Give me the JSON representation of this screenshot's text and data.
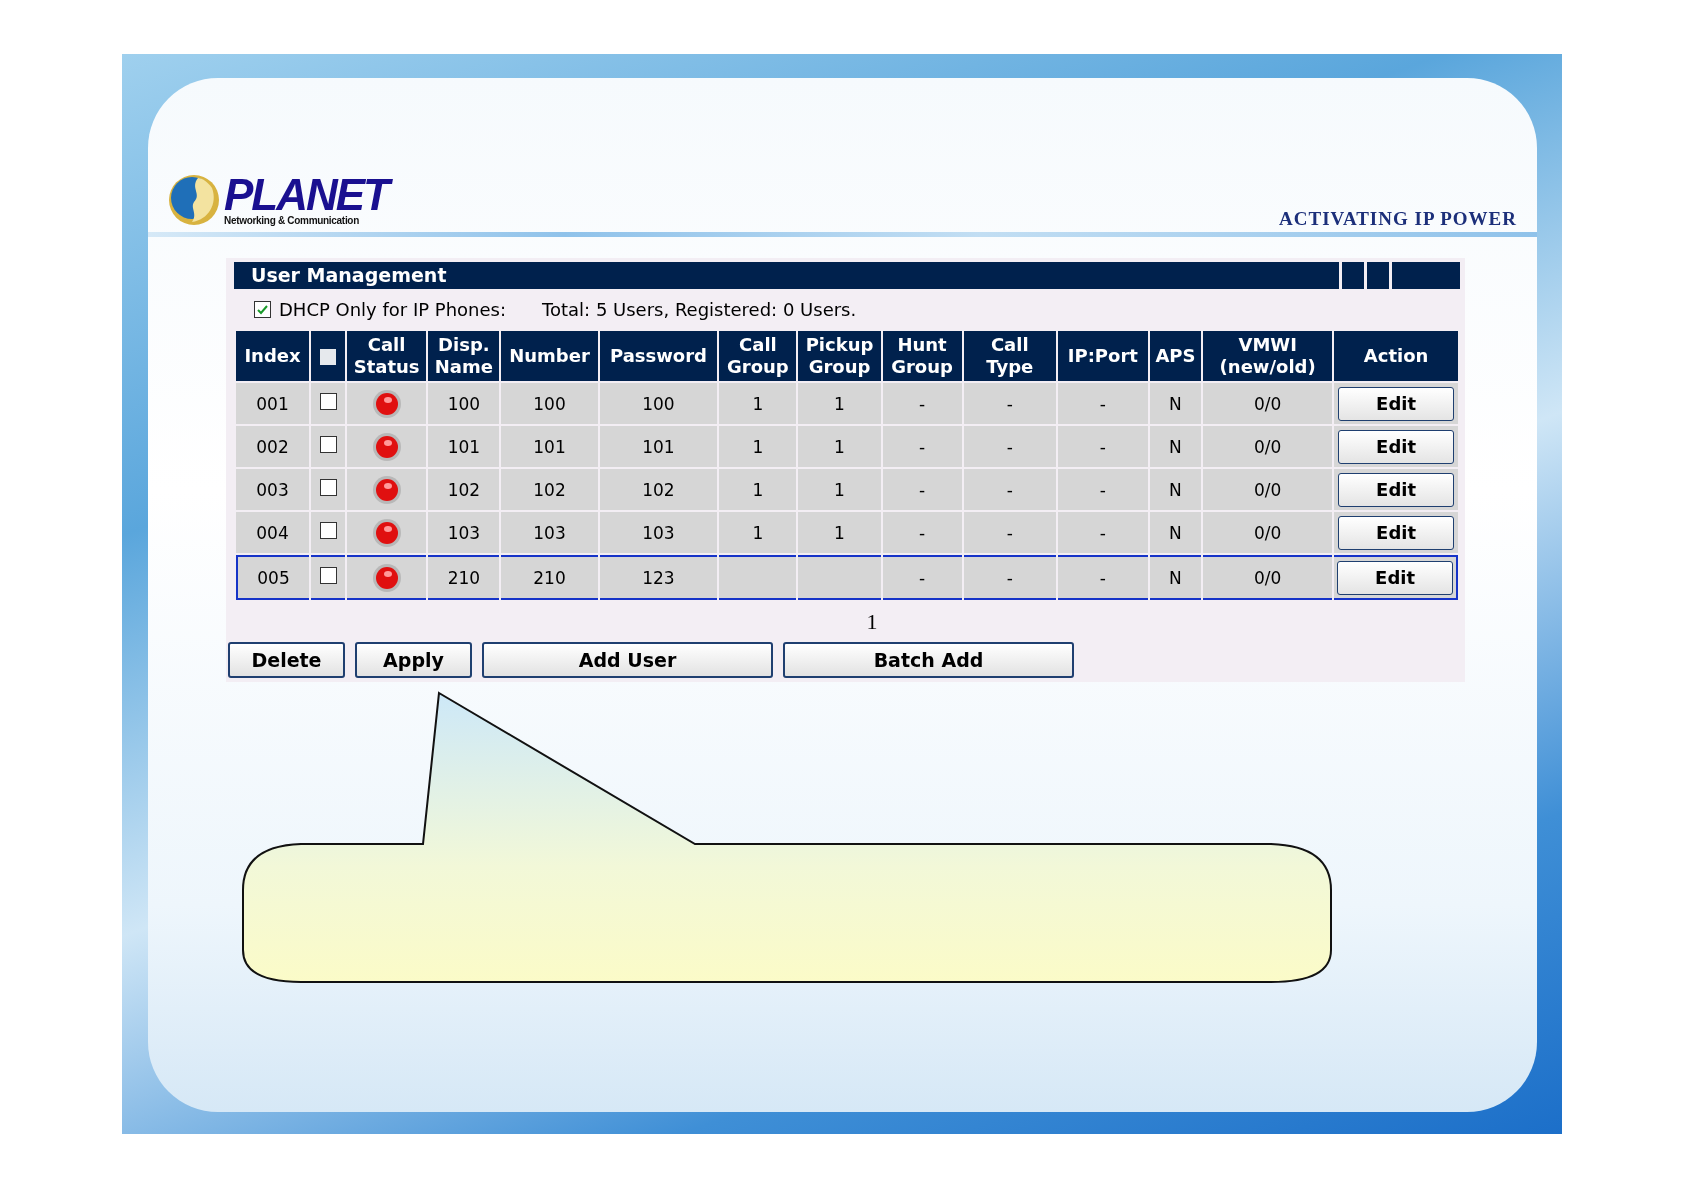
{
  "logo": {
    "name": "PLANET",
    "subtitle": "Networking & Communication"
  },
  "tagline": "ACTIVATING IP POWER",
  "panel": {
    "title": "User Management",
    "dhcp": {
      "label": "DHCP Only for IP Phones:",
      "checked": true
    },
    "summary": "Total: 5 Users, Registered: 0 Users.",
    "columns": [
      {
        "kind": "text",
        "label": "Index"
      },
      {
        "kind": "select_all",
        "checked": false
      },
      {
        "kind": "text",
        "label": "Call\nStatus"
      },
      {
        "kind": "text",
        "label": "Disp.\nName"
      },
      {
        "kind": "text",
        "label": "Number"
      },
      {
        "kind": "text",
        "label": "Password"
      },
      {
        "kind": "text",
        "label": "Call\nGroup"
      },
      {
        "kind": "text",
        "label": "Pickup\nGroup"
      },
      {
        "kind": "text",
        "label": "Hunt\nGroup"
      },
      {
        "kind": "text",
        "label": "Call\nType"
      },
      {
        "kind": "text",
        "label": "IP:Port"
      },
      {
        "kind": "text",
        "label": "APS"
      },
      {
        "kind": "text",
        "label": "VMWI\n(new/old)"
      },
      {
        "kind": "text",
        "label": "Action"
      }
    ],
    "rows": [
      {
        "index": "001",
        "checked": false,
        "selected": false,
        "disp_name": "100",
        "number": "100",
        "password": "100",
        "call_group": "1",
        "pickup_group": "1",
        "hunt_group": "-",
        "call_type": "-",
        "ip_port": "-",
        "aps": "N",
        "vmwi": "0/0",
        "action": "Edit"
      },
      {
        "index": "002",
        "checked": false,
        "selected": false,
        "disp_name": "101",
        "number": "101",
        "password": "101",
        "call_group": "1",
        "pickup_group": "1",
        "hunt_group": "-",
        "call_type": "-",
        "ip_port": "-",
        "aps": "N",
        "vmwi": "0/0",
        "action": "Edit"
      },
      {
        "index": "003",
        "checked": false,
        "selected": false,
        "disp_name": "102",
        "number": "102",
        "password": "102",
        "call_group": "1",
        "pickup_group": "1",
        "hunt_group": "-",
        "call_type": "-",
        "ip_port": "-",
        "aps": "N",
        "vmwi": "0/0",
        "action": "Edit"
      },
      {
        "index": "004",
        "checked": false,
        "selected": false,
        "disp_name": "103",
        "number": "103",
        "password": "103",
        "call_group": "1",
        "pickup_group": "1",
        "hunt_group": "-",
        "call_type": "-",
        "ip_port": "-",
        "aps": "N",
        "vmwi": "0/0",
        "action": "Edit"
      },
      {
        "index": "005",
        "checked": false,
        "selected": true,
        "disp_name": "210",
        "number": "210",
        "password": "123",
        "hunt_group": "-",
        "call_type": "-",
        "ip_port": "-",
        "aps": "N",
        "vmwi": "0/0",
        "action": "Edit"
      }
    ],
    "page": "1",
    "buttons": [
      "Delete",
      "Apply",
      "Add User",
      "Batch Add"
    ]
  }
}
